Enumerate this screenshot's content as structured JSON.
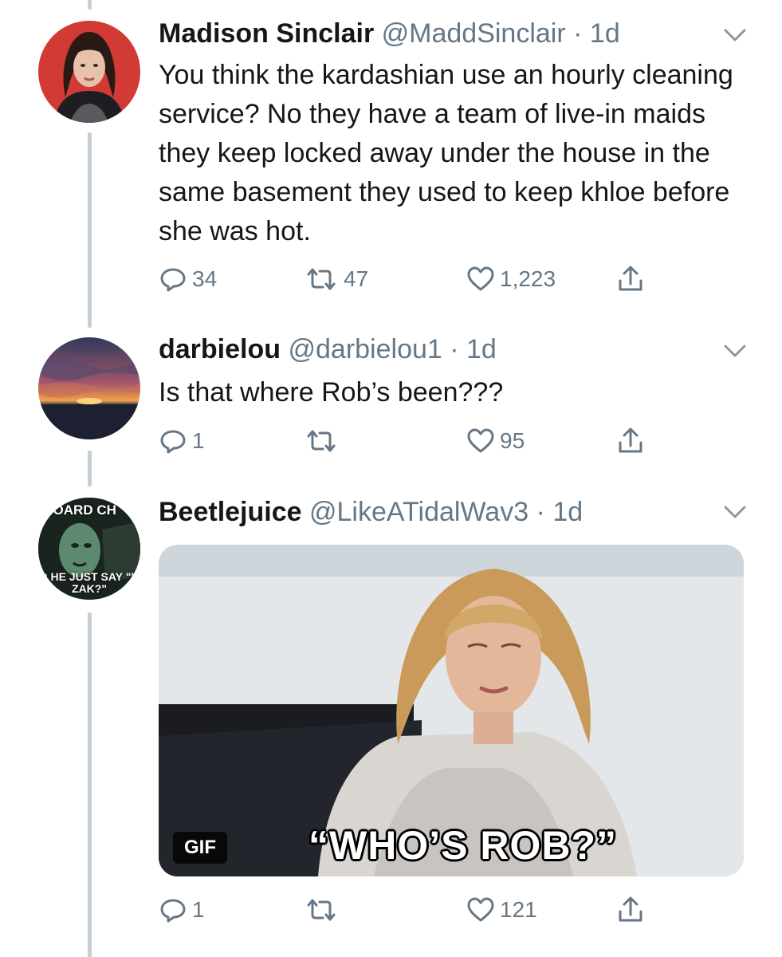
{
  "tweets": [
    {
      "name": "Madison Sinclair",
      "handle": "@MaddSinclair",
      "time": "1d",
      "text": "You think the kardashian use an hourly cleaning service? No they have a team of live-in maids they keep locked away under the house in the same basement they used to keep khloe before she was hot.",
      "reply_count": "34",
      "retweet_count": "47",
      "like_count": "1,223"
    },
    {
      "name": "darbielou",
      "handle": "@darbielou1",
      "time": "1d",
      "text": "Is that where Rob’s been???",
      "reply_count": "1",
      "retweet_count": "",
      "like_count": "95"
    },
    {
      "name": "Beetlejuice",
      "handle": "@LikeATidalWav3",
      "time": "1d",
      "avatar_text_top": "RBOARD CH",
      "avatar_text_bottom": "D HE JUST SAY \"K ZAK?\"",
      "media": {
        "badge": "GIF",
        "caption": "“WHO’S ROB?”"
      },
      "reply_count": "1",
      "retweet_count": "",
      "like_count": "121"
    }
  ],
  "separator": " · ",
  "icons": {
    "reply": "reply-icon",
    "retweet": "retweet-icon",
    "like": "heart-icon",
    "share": "share-icon",
    "menu": "chevron-down-icon"
  },
  "colors": {
    "text": "#14171a",
    "muted": "#657786",
    "thread_line": "#c4cfd6"
  }
}
